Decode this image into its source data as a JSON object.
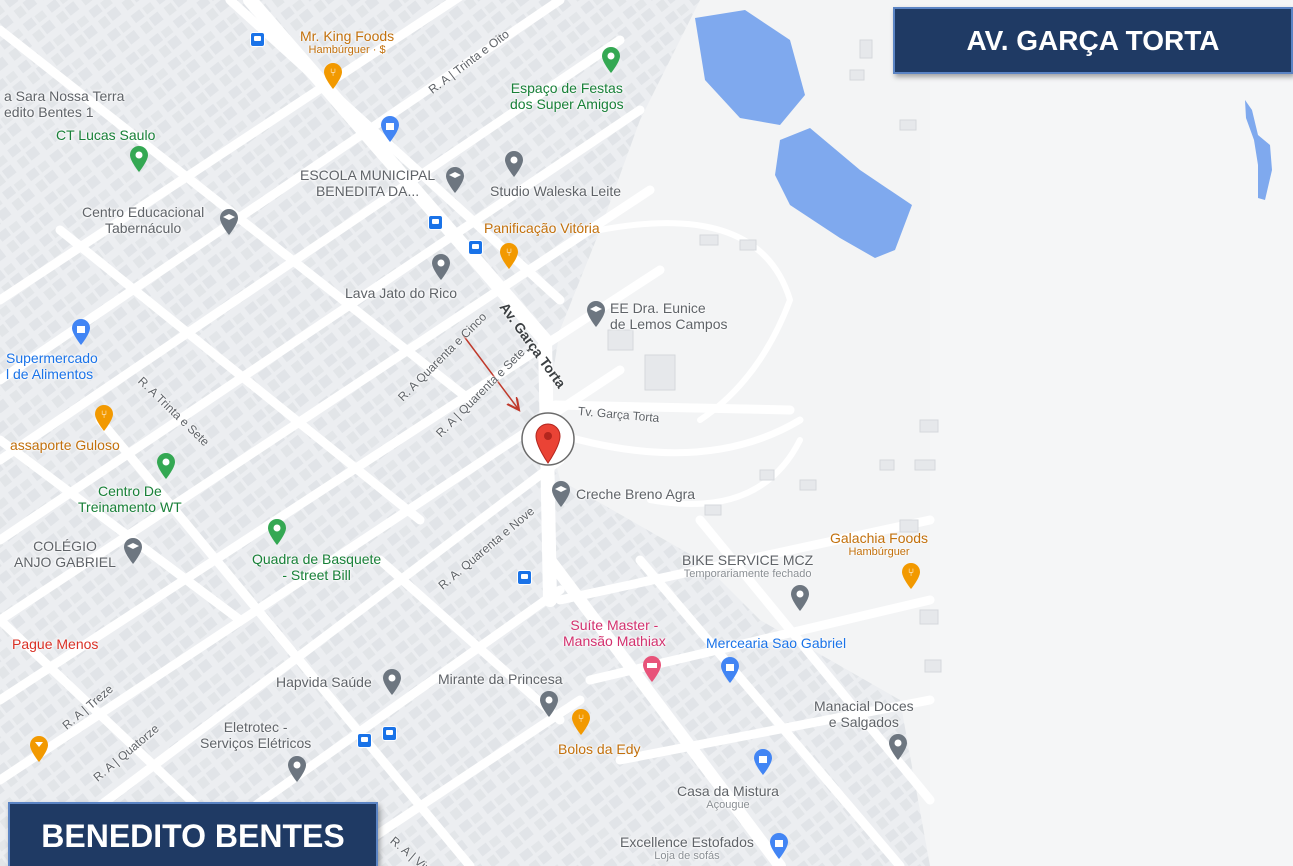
{
  "title_boxes": {
    "avenue": "AV. GARÇA TORTA",
    "neighborhood": "BENEDITO BENTES"
  },
  "streets": {
    "main_avenue": "Av. Garça Torta",
    "travessa": "Tv. Garça Torta",
    "r_trinta_e_oito": "R. A | Trinta e Oito",
    "r_quarenta_e_cinco": "R. A Quarenta e Cinco",
    "r_quarenta_e_sete": "R. A | Quarenta e Sete",
    "r_trinta_e_sete": "R. A Trinta e Sete",
    "r_quarenta_e_nove": "R. A. Quarenta e Nove",
    "r_treze": "R. A | Treze",
    "r_quatorze": "R. A | Quatorze",
    "r_vinte": "R. A | Vint"
  },
  "places": {
    "mr_king": {
      "name": "Mr. King Foods",
      "sub": "Hambúrguer · $"
    },
    "sara": {
      "name_line1": "a Sara Nossa Terra",
      "name_line2": "edito Bentes 1"
    },
    "espaco_festas": {
      "name_line1": "Espaço de Festas",
      "name_line2": "dos Super Amigos"
    },
    "ct_lucas": {
      "name": "CT Lucas Saulo"
    },
    "escola_municipal": {
      "name_line1": "ESCOLA MUNICIPAL",
      "name_line2": "BENEDITA DA..."
    },
    "studio": {
      "name": "Studio Waleska Leite"
    },
    "centro_educacional": {
      "name_line1": "Centro Educacional",
      "name_line2": "Tabernáculo"
    },
    "panificacao": {
      "name": "Panificação Vitória"
    },
    "lava_jato": {
      "name": "Lava Jato do Rico"
    },
    "ee_eunice": {
      "name_line1": "EE Dra. Eunice",
      "name_line2": "de Lemos Campos"
    },
    "supermercado": {
      "name_line1": "Supermercado",
      "name_line2": "l de Alimentos"
    },
    "passaporte": {
      "name": "assaporte Guloso"
    },
    "centro_treinamento": {
      "name_line1": "Centro De",
      "name_line2": "Treinamento WT"
    },
    "creche": {
      "name": "Creche Breno Agra"
    },
    "colegio": {
      "name_line1": "COLÉGIO",
      "name_line2": "ANJO GABRIEL"
    },
    "quadra": {
      "name_line1": "Quadra de Basquete",
      "name_line2": "- Street Bill"
    },
    "galachia": {
      "name": "Galachia Foods",
      "sub": "Hambúrguer"
    },
    "bike_service": {
      "name": "BIKE SERVICE MCZ",
      "sub": "Temporariamente fechado"
    },
    "suite_master": {
      "name_line1": "Suíte Master -",
      "name_line2": "Mansão Mathiax"
    },
    "mercearia": {
      "name": "Mercearia Sao Gabriel"
    },
    "pague_menos": {
      "name": "Pague Menos"
    },
    "hapvida": {
      "name": "Hapvida Saúde"
    },
    "mirante": {
      "name": "Mirante da Princesa"
    },
    "manacial": {
      "name_line1": "Manacial Doces",
      "name_line2": "e Salgados"
    },
    "eletrotec": {
      "name_line1": "Eletrotec -",
      "name_line2": "Serviços Elétricos"
    },
    "bolos": {
      "name": "Bolos da Edy"
    },
    "casa_mistura": {
      "name": "Casa da Mistura",
      "sub": "Açougue"
    },
    "excellence": {
      "name": "Excellence Estofados",
      "sub": "Loja de sofás"
    }
  },
  "colors": {
    "water": "#7fa9ee",
    "road": "#ffffff",
    "land": "#eef0f2",
    "block": "#e4e7ea",
    "title_box": "#1f3a64",
    "marker": "#ea4335",
    "arrow": "#c0392b"
  }
}
